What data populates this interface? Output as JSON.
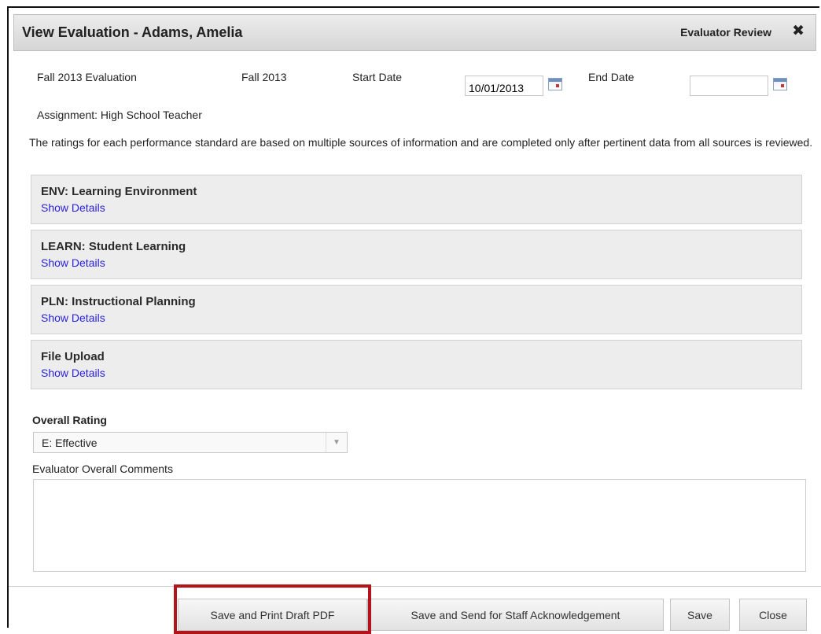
{
  "dialog": {
    "title": "View Evaluation - Adams, Amelia",
    "status": "Evaluator Review",
    "close_glyph": "✖"
  },
  "evaluation": {
    "name": "Fall 2013 Evaluation",
    "term": "Fall 2013",
    "start_date_label": "Start Date",
    "start_date_value": "10/01/2013",
    "end_date_label": "End Date",
    "end_date_value": "",
    "assignment": "Assignment: High School Teacher",
    "intro": "The ratings for each performance standard are based on multiple sources of information and are completed only after pertinent data from all sources is reviewed."
  },
  "sections": [
    {
      "title": "ENV: Learning Environment",
      "link": "Show Details"
    },
    {
      "title": "LEARN: Student Learning",
      "link": "Show Details"
    },
    {
      "title": "PLN: Instructional Planning",
      "link": "Show Details"
    },
    {
      "title": "File Upload",
      "link": "Show Details"
    }
  ],
  "overall": {
    "label": "Overall Rating",
    "selected": "E: Effective",
    "arrow_glyph": "▼",
    "comments_label": "Evaluator Overall Comments",
    "comments_value": ""
  },
  "footer": {
    "save_print": "Save and Print Draft PDF",
    "save_send": "Save and Send for Staff Acknowledgement",
    "save": "Save",
    "close": "Close"
  },
  "colors": {
    "link": "#2a1fd9",
    "highlight": "#b3141b"
  },
  "icons": {
    "calendar": "calendar-icon",
    "close": "close-icon",
    "dropdown": "chevron-down-icon"
  }
}
